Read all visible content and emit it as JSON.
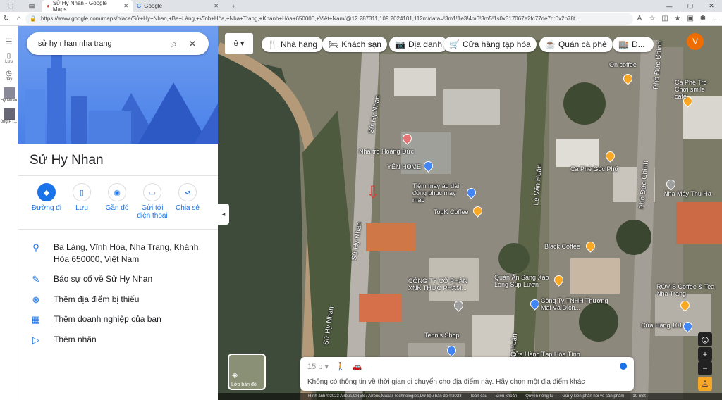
{
  "browser": {
    "tabs": [
      {
        "label": "Sử Hy Nhan - Google Maps",
        "active": true
      },
      {
        "label": "Google",
        "active": false
      }
    ],
    "url": "https://www.google.com/maps/place/Sử+Hy+Nhan,+Ba+Làng,+Vĩnh+Hòa,+Nha+Trang,+Khánh+Hòa+650000,+Việt+Nam/@12.287311,109.2024101,112m/data=!3m1!1e3!4m6!3m5!1s0x317067e2fc77de7d:0x2b78f..."
  },
  "edge_sidebar": {
    "items": [
      "Lưu",
      "đây",
      "Hy Nhan",
      "ông PT..."
    ]
  },
  "panel": {
    "search_value": "sử hy nhan nha trang",
    "place_title": "Sử Hy Nhan",
    "actions": [
      {
        "label": "Đường đi",
        "icon": "directions-icon"
      },
      {
        "label": "Lưu",
        "icon": "bookmark-icon"
      },
      {
        "label": "Gần đó",
        "icon": "nearby-icon"
      },
      {
        "label": "Gửi tới điện thoại",
        "icon": "send-to-phone-icon"
      },
      {
        "label": "Chia sẻ",
        "icon": "share-icon"
      }
    ],
    "address": "Ba Làng, Vĩnh Hòa, Nha Trang, Khánh Hòa 650000, Việt Nam",
    "rows": [
      {
        "label": "Báo sự cố về Sử Hy Nhan",
        "icon": "pencil-icon"
      },
      {
        "label": "Thêm địa điểm bị thiếu",
        "icon": "add-location-icon"
      },
      {
        "label": "Thêm doanh nghiệp của bạn",
        "icon": "add-business-icon"
      },
      {
        "label": "Thêm nhãn",
        "icon": "label-icon"
      }
    ]
  },
  "map": {
    "chips": [
      "Nhà hàng",
      "Khách sạn",
      "Địa danh",
      "Cửa hàng tạp hóa",
      "Quán cà phê",
      "Đ..."
    ],
    "avatar_letter": "V",
    "roads": [
      "Sử Hy Nhan",
      "Sử Hy Nhan",
      "Sử Hy Nhan",
      "Lê Văn Huân",
      "Lê Văn Huân",
      "Phó Đức Chính",
      "Phó Đức Chính"
    ],
    "places": [
      "Nhà trọ Hoàng Đức",
      "YẾN HOME",
      "Tiệm may áo dài đồng phục may mặc",
      "TopK Coffee",
      "Cà Phê Góc Phố",
      "On coffee",
      "Cà Phê Trò Chơi smile cafe",
      "Nhà Máy Thu Hà",
      "Black Coffee",
      "Quán Ăn Sáng Xào Lòng Súp Lươn",
      "CÔNG TY CỔ PHẦN XNK THỰC PHẨM...",
      "Công Ty TNHH Thương Mại Và Dịch...",
      "ROVIS Coffee & Tea Nha Trang",
      "Cửa Hàng 101",
      "Tennis Shop",
      "Cửa Hàng Tạp Hóa Tình"
    ],
    "layer_label": "Lớp bản đồ",
    "travel_time": "15 p",
    "info_text": "Không có thông tin về thời gian di chuyển cho địa điểm này. Hãy chọn một địa điểm khác",
    "footer": [
      "Hình ảnh ©2023 Airbus,CNES / Airbus,Maxar Technologies,Dữ liệu bản đồ ©2023",
      "Toàn cầu",
      "Điều khoản",
      "Quyền riêng tư",
      "Gửi ý kiến phản hồi về sản phẩm",
      "10 mét"
    ]
  }
}
